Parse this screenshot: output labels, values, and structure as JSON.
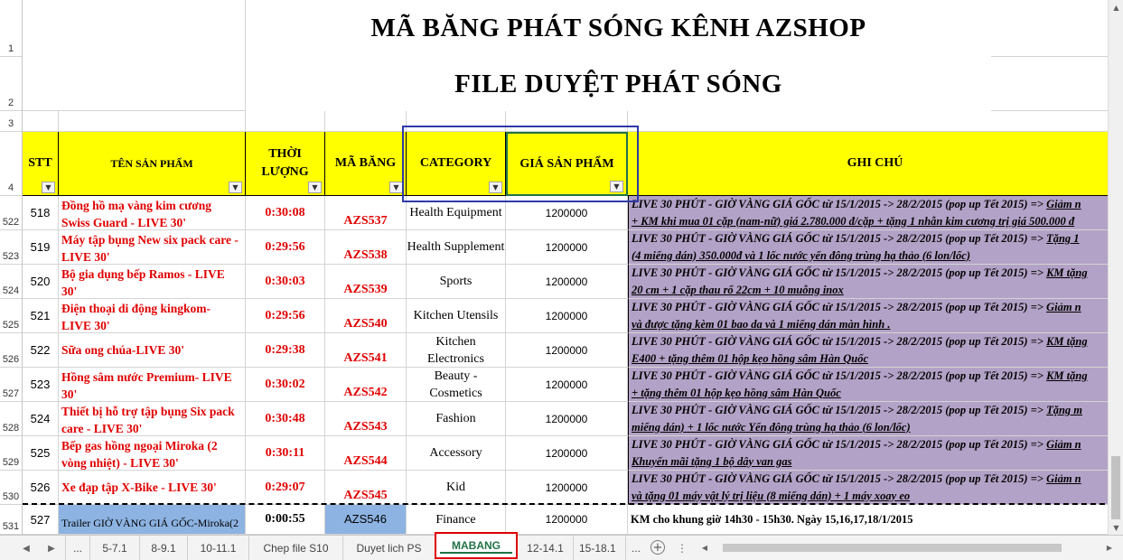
{
  "title": "MÃ BĂNG PHÁT SÓNG  KÊNH AZSHOP",
  "subtitle": "FILE DUYỆT PHÁT SÓNG",
  "row_headers_top": [
    "1",
    "2",
    "3",
    "4"
  ],
  "headers": {
    "stt": "STT",
    "name": "TÊN SẢN PHẨM",
    "duration_1": "THỜI",
    "duration_2": "LƯỢNG",
    "code": "MÃ BĂNG",
    "category": "CATEGORY",
    "price": "GIÁ SẢN PHẨM",
    "note": "GHI CHÚ"
  },
  "rows": [
    {
      "rownum": "522",
      "stt": "518",
      "name": "Đồng hồ mạ vàng kim cương Swiss Guard - LIVE 30'",
      "duration": "0:30:08",
      "code": "AZS537",
      "category": "Health Equipment",
      "price": "1200000",
      "note1a": "LIVE 30 PHÚT - GIỜ VÀNG GIÁ GỐC từ 15/1/2015 -> 28/2/2015 (pop up Tết 2015) => ",
      "note1b": "Giảm n",
      "note2": "+ KM khi mua 01 cặp (nam-nữ) giá 2.780.000 đ/cặp + tặng 1 nhẫn kim cương trị giá 500.000 đ"
    },
    {
      "rownum": "523",
      "stt": "519",
      "name": "Máy tập bụng New six pack care - LIVE 30'",
      "duration": "0:29:56",
      "code": "AZS538",
      "category": "Health Supplement",
      "price": "1200000",
      "note1a": "LIVE 30 PHÚT - GIỜ VÀNG GIÁ GỐC từ 15/1/2015 -> 28/2/2015 (pop up Tết 2015) => ",
      "note1b": "Tặng 1",
      "note2": "(4 miếng dán) 350.000đ  và 1 lốc nước yến đông trùng hạ thảo (6 lon/lốc)"
    },
    {
      "rownum": "524",
      "stt": "520",
      "name": "Bộ gia dụng bếp Ramos - LIVE 30'",
      "duration": "0:30:03",
      "code": "AZS539",
      "category": "Sports",
      "price": "1200000",
      "note1a": "LIVE 30 PHÚT - GIỜ VÀNG GIÁ GỐC từ 15/1/2015 -> 28/2/2015 (pop up Tết 2015) => ",
      "note1b": "KM tặng",
      "note2": "20 cm + 1 cặp thau rổ 22cm + 10 muỗng inox"
    },
    {
      "rownum": "525",
      "stt": "521",
      "name": "Điện thoại di động kingkom- LIVE 30'",
      "duration": "0:29:56",
      "code": "AZS540",
      "category": "Kitchen Utensils",
      "price": "1200000",
      "note1a": "LIVE 30 PHÚT - GIỜ VÀNG GIÁ GỐC từ 15/1/2015 -> 28/2/2015 (pop up Tết 2015) => ",
      "note1b": "Giảm n",
      "note2": "và được tặng kèm 01 bao da và 1 miếng dán màn hình ."
    },
    {
      "rownum": "526",
      "stt": "522",
      "name": "Sữa ong chúa-LIVE 30'",
      "duration": "0:29:38",
      "code": "AZS541",
      "category": "Kitchen Electronics",
      "price": "1200000",
      "note1a": "LIVE 30 PHÚT - GIỜ VÀNG GIÁ GỐC từ 15/1/2015 -> 28/2/2015 (pop up Tết 2015) => ",
      "note1b": "KM tặng",
      "note2": "E400 + tặng thêm 01 hộp kẹo hồng sâm Hàn Quốc"
    },
    {
      "rownum": "527",
      "stt": "523",
      "name": "Hồng sâm nước Premium- LIVE 30'",
      "duration": "0:30:02",
      "code": "AZS542",
      "category": "Beauty - Cosmetics",
      "price": "1200000",
      "note1a": "LIVE 30 PHÚT - GIỜ VÀNG GIÁ GỐC từ 15/1/2015 -> 28/2/2015 (pop up Tết 2015) => ",
      "note1b": "KM tặng",
      "note2": "+ tặng thêm 01 hộp kẹo hồng sâm Hàn Quốc"
    },
    {
      "rownum": "528",
      "stt": "524",
      "name": "Thiết bị hỗ trợ tập bụng Six pack care - LIVE 30'",
      "duration": "0:30:48",
      "code": "AZS543",
      "category": "Fashion",
      "price": "1200000",
      "note1a": "LIVE 30 PHÚT - GIỜ VÀNG GIÁ GỐC từ 15/1/2015 -> 28/2/2015 (pop up Tết 2015) => ",
      "note1b": "Tặng m",
      "note2": "miếng dán) + 1 lốc nước Yến đông trùng hạ thảo (6 lon/lốc)"
    },
    {
      "rownum": "529",
      "stt": "525",
      "name": "Bếp gas hồng ngoại Miroka (2 vòng nhiệt) - LIVE 30'",
      "duration": "0:30:11",
      "code": "AZS544",
      "category": "Accessory",
      "price": "1200000",
      "note1a": "LIVE 30 PHÚT - GIỜ VÀNG GIÁ GỐC từ 15/1/2015 -> 28/2/2015 (pop up Tết 2015) => ",
      "note1b": "Giảm n",
      "note2": "Khuyến mãi tặng 1 bộ dây van gas"
    },
    {
      "rownum": "530",
      "stt": "526",
      "name": "Xe đạp tập X-Bike - LIVE 30'",
      "duration": "0:29:07",
      "code": "AZS545",
      "category": "Kid",
      "price": "1200000",
      "note1a": "LIVE 30 PHÚT - GIỜ VÀNG GIÁ GỐC từ 15/1/2015 -> 28/2/2015 (pop up Tết 2015) => ",
      "note1b": "Giảm n",
      "note2": "và tặng 01 máy vật lý trị liệu (8 miếng dán) + 1 máy xoay eo"
    }
  ],
  "last_row": {
    "rownum": "531",
    "stt": "527",
    "name": "Trailer GIỜ VÀNG GIÁ GỐC-Miroka(2",
    "duration": "0:00:55",
    "code": "AZS546",
    "category": "Finance",
    "price": "1200000",
    "note": "KM cho khung giờ 14h30 - 15h30. Ngày 15,16,17,18/1/2015"
  },
  "tabs": {
    "ellipsis_left": "...",
    "items": [
      "5-7.1",
      "8-9.1",
      "10-11.1",
      "Chep file S10",
      "Duyet lich PS",
      "MABANG",
      "12-14.1",
      "15-18.1"
    ],
    "ellipsis_right": "..."
  },
  "colors": {
    "header_bg": "#ffff00",
    "note_bg": "#b3a2c7",
    "trailer_bg": "#8db3e2",
    "product_text": "#e00000",
    "active_tab": "#217346"
  }
}
